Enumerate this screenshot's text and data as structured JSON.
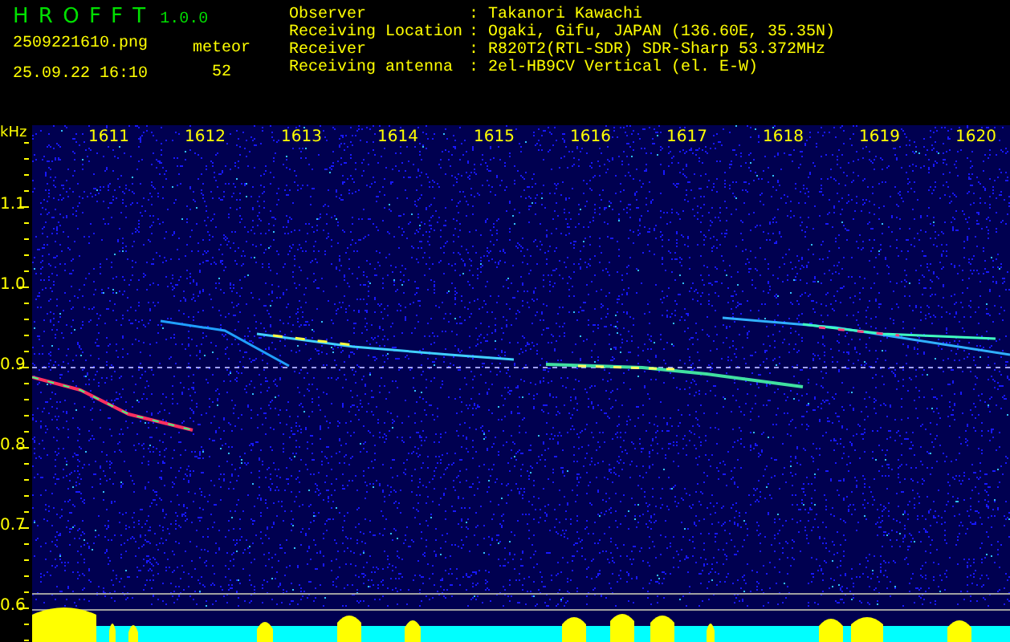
{
  "app": {
    "title": "H R O F F T",
    "version": "1.0.0"
  },
  "file": {
    "name": "2509221610.png",
    "datetime": "25.09.22 16:10"
  },
  "counter": {
    "label": "meteor",
    "value": "52"
  },
  "info": [
    {
      "label": "Observer",
      "separator": ":",
      "value": "Takanori Kawachi"
    },
    {
      "label": "Receiving Location",
      "separator": ":",
      "value": "Ogaki, Gifu, JAPAN (136.60E, 35.35N)"
    },
    {
      "label": "Receiver",
      "separator": ":",
      "value": "R820T2(RTL-SDR) SDR-Sharp 53.372MHz"
    },
    {
      "label": "Receiving antenna",
      "separator": ":",
      "value": "2el-HB9CV Vertical (el. E-W)"
    }
  ],
  "plot": {
    "unit": "kHz",
    "x_labels": [
      "1611",
      "1612",
      "1613",
      "1614",
      "1615",
      "1616",
      "1617",
      "1618",
      "1619",
      "1620"
    ],
    "y_labels": [
      "1.1",
      "1.0",
      "0.9",
      "0.8",
      "0.7",
      "0.6"
    ]
  }
}
